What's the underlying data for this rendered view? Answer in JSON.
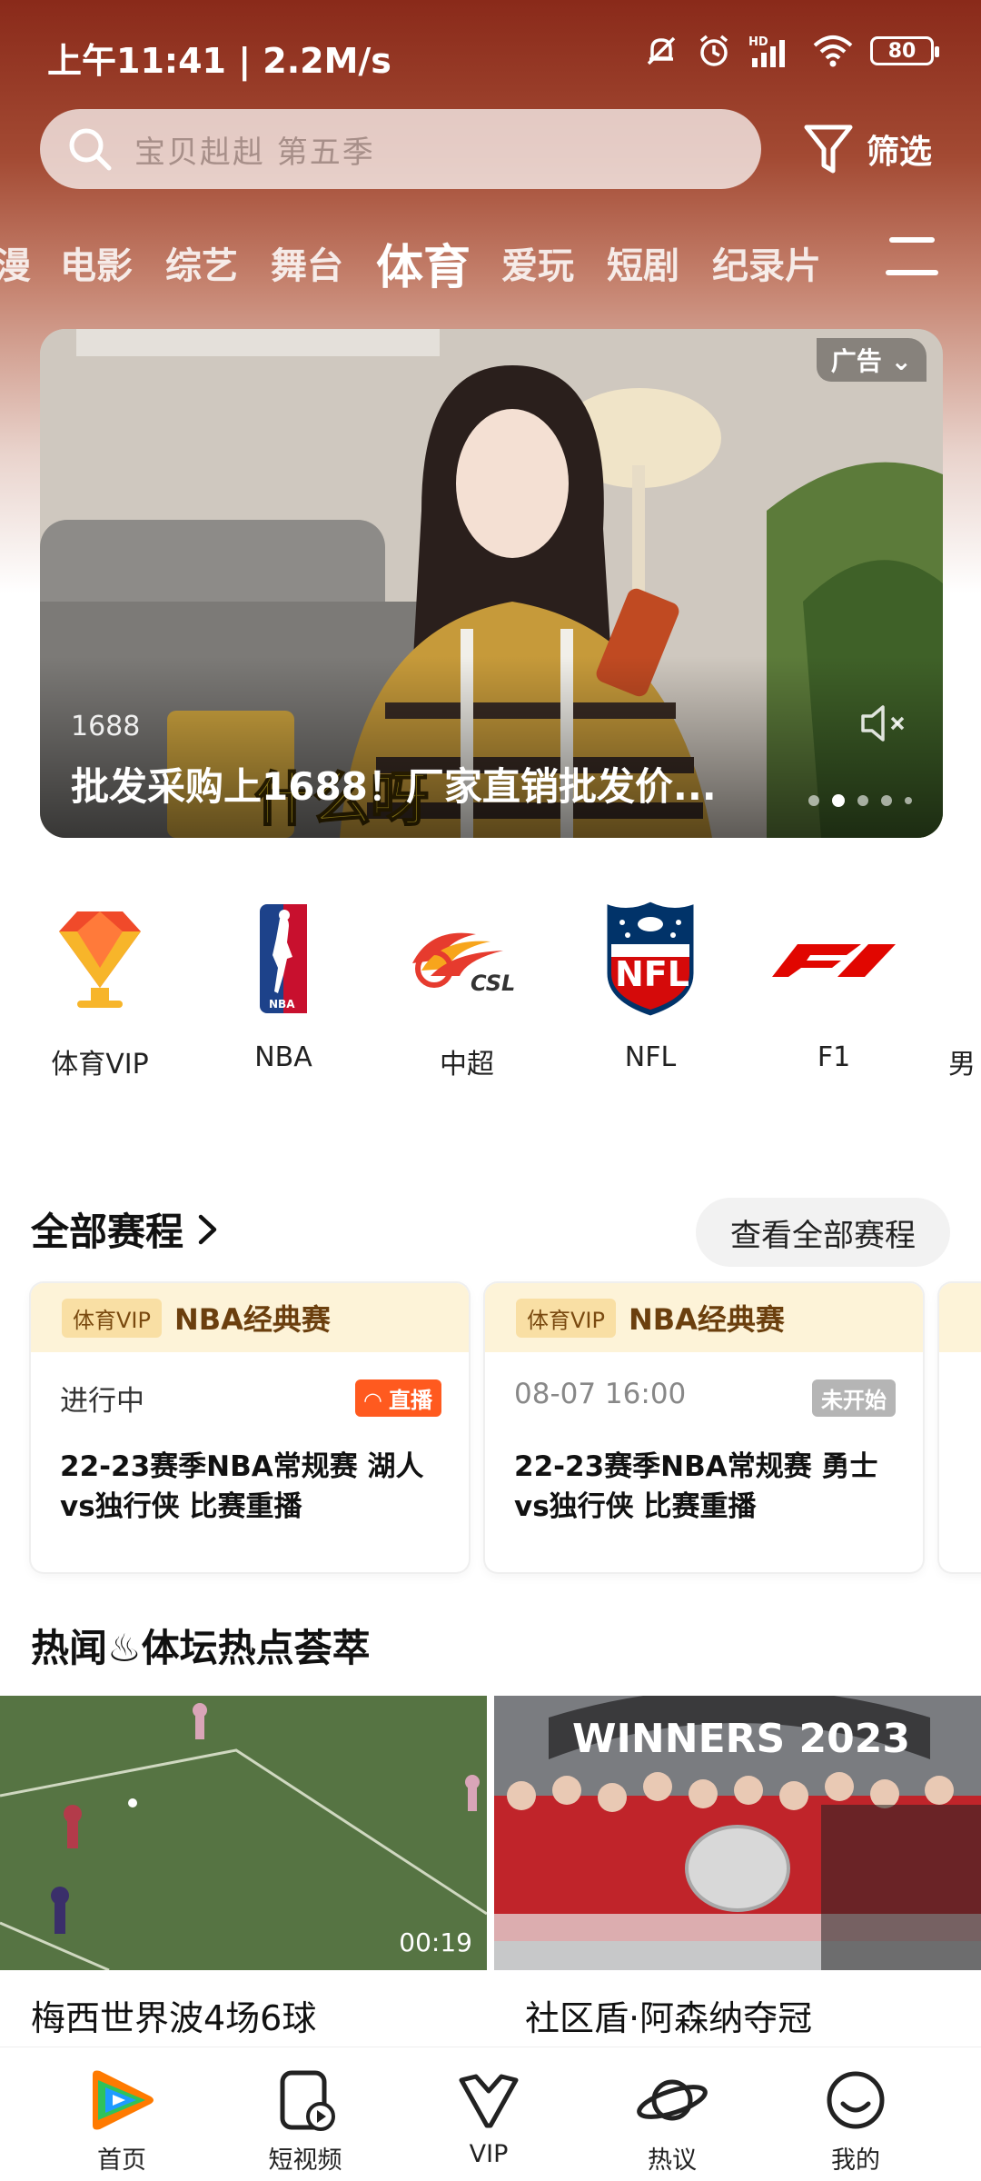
{
  "status_bar": {
    "time": "上午11:41 | 2.2M/s",
    "battery": "80",
    "icons": [
      "mute-bell-icon",
      "alarm-icon",
      "hd-signal-icon",
      "wifi-icon",
      "battery-icon"
    ]
  },
  "search": {
    "placeholder": "宝贝赳赳 第五季",
    "filter_label": "筛选"
  },
  "tabs": [
    "漫",
    "电影",
    "综艺",
    "舞台",
    "体育",
    "爱玩",
    "短剧",
    "纪录片"
  ],
  "active_tab": "体育",
  "banner": {
    "ad_tag": "广告",
    "source": "1688",
    "title": "批发采购上1688！厂家直销批发价...",
    "dots": 5,
    "active_dot": 2
  },
  "sports": [
    {
      "label": "体育VIP",
      "icon": "vip-diamond-icon"
    },
    {
      "label": "NBA",
      "icon": "nba-logo-icon"
    },
    {
      "label": "中超",
      "icon": "csl-logo-icon"
    },
    {
      "label": "NFL",
      "icon": "nfl-logo-icon"
    },
    {
      "label": "F1",
      "icon": "f1-logo-icon"
    },
    {
      "label": "男",
      "icon": "partial-logo-icon"
    }
  ],
  "schedule": {
    "title": "全部赛程",
    "view_all": "查看全部赛程",
    "cards": [
      {
        "vip_tag": "体育VIP",
        "league": "NBA经典赛",
        "status": "进行中",
        "badge": "直播",
        "title": "22-23赛季NBA常规赛 湖人vs独行侠 比赛重播"
      },
      {
        "vip_tag": "体育VIP",
        "league": "NBA经典赛",
        "status": "08-07 16:00",
        "badge": "未开始",
        "title": "22-23赛季NBA常规赛 勇士vs独行侠 比赛重播"
      }
    ]
  },
  "hot": {
    "title": "热闻♨体坛热点荟萃",
    "items": [
      {
        "caption": "梅西世界波4场6球",
        "duration": "00:19"
      },
      {
        "caption": "社区盾·阿森纳夺冠",
        "banner_text": "WINNERS 2023"
      }
    ]
  },
  "nav": [
    {
      "label": "首页",
      "icon": "home-play-icon"
    },
    {
      "label": "短视频",
      "icon": "short-video-icon"
    },
    {
      "label": "VIP",
      "icon": "vip-crown-icon"
    },
    {
      "label": "热议",
      "icon": "discuss-planet-icon"
    },
    {
      "label": "我的",
      "icon": "profile-smile-icon"
    }
  ]
}
